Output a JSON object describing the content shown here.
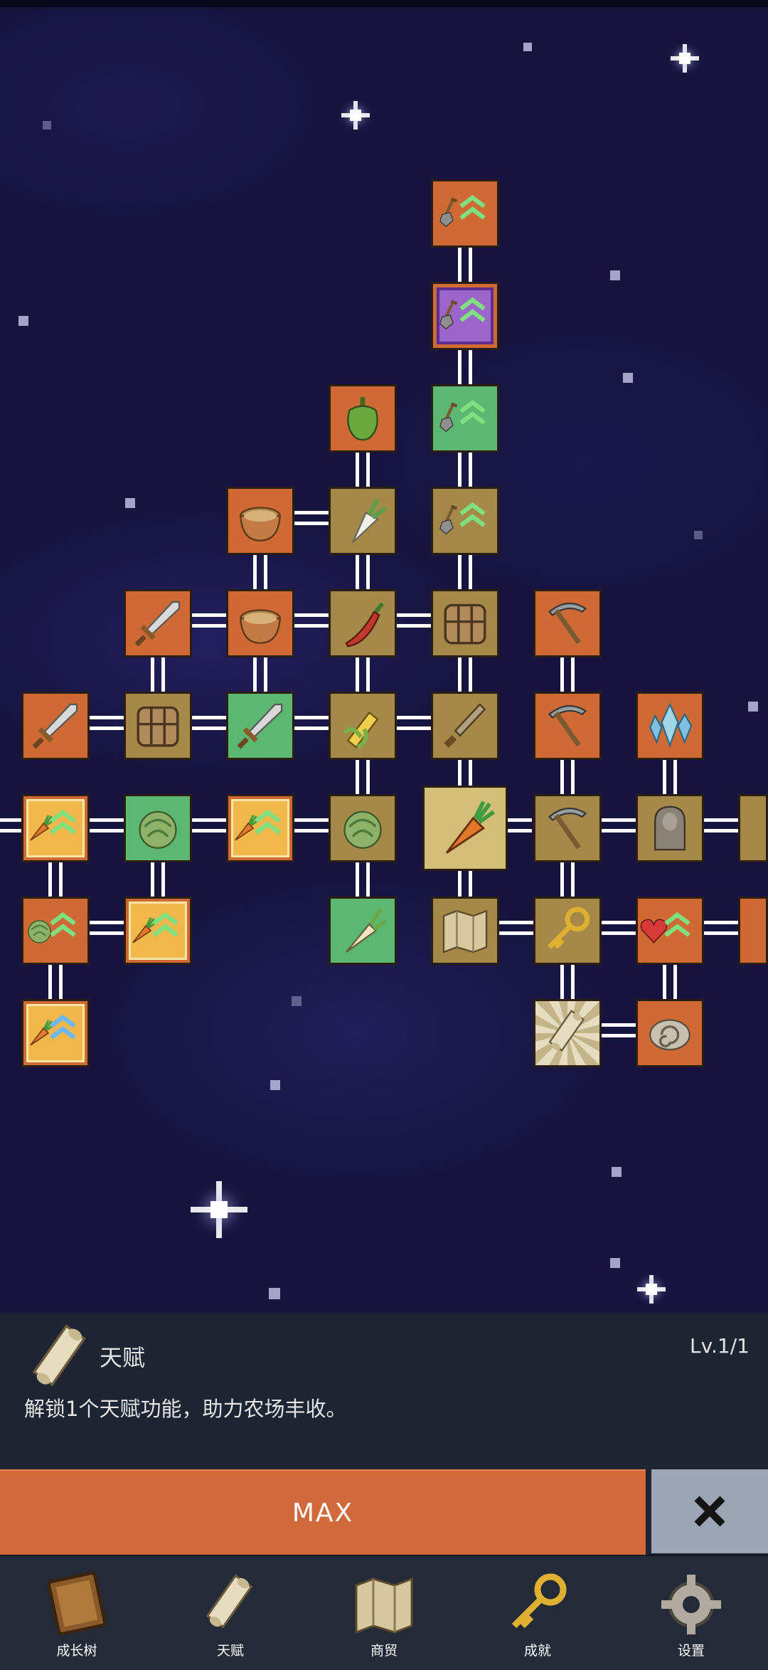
{
  "tree": {
    "nodes": [
      {
        "id": "shovel-upgrade-orange",
        "icon": "shovel-icon"
      },
      {
        "id": "shovel-upgrade-purple",
        "icon": "shovel-icon"
      },
      {
        "id": "pepper-node",
        "icon": "bell-pepper-icon"
      },
      {
        "id": "shovel-upgrade-green",
        "icon": "shovel-icon"
      },
      {
        "id": "bowl-node-top",
        "icon": "bowl-icon"
      },
      {
        "id": "radish-node",
        "icon": "radish-icon"
      },
      {
        "id": "shovel-upgrade-olive",
        "icon": "shovel-icon"
      },
      {
        "id": "sword-node-gold",
        "icon": "sword-icon"
      },
      {
        "id": "bowl-node",
        "icon": "bowl-icon"
      },
      {
        "id": "chili-node",
        "icon": "chili-pepper-icon"
      },
      {
        "id": "chest-node-top",
        "icon": "chest-icon"
      },
      {
        "id": "pickaxe-gold-node",
        "icon": "pickaxe-icon"
      },
      {
        "id": "sword-node-orange",
        "icon": "sword-icon"
      },
      {
        "id": "chest-node",
        "icon": "chest-icon"
      },
      {
        "id": "sword-node-green",
        "icon": "sword-icon"
      },
      {
        "id": "corn-node",
        "icon": "corn-icon"
      },
      {
        "id": "dagger-node",
        "icon": "dagger-icon"
      },
      {
        "id": "pickaxe-node",
        "icon": "pickaxe-icon"
      },
      {
        "id": "crystal-node",
        "icon": "crystal-icon"
      },
      {
        "id": "carrot-upgrade-1",
        "icon": "carrot-icon"
      },
      {
        "id": "cabbage-node-green",
        "icon": "cabbage-icon"
      },
      {
        "id": "carrot-upgrade-2",
        "icon": "carrot-icon"
      },
      {
        "id": "cabbage-node-olive",
        "icon": "cabbage-icon"
      },
      {
        "id": "carrot-center-node",
        "icon": "carrot-icon"
      },
      {
        "id": "pickaxe-node-2",
        "icon": "pickaxe-icon"
      },
      {
        "id": "statue-node",
        "icon": "statue-icon"
      },
      {
        "id": "cabbage-upgrade",
        "icon": "cabbage-icon"
      },
      {
        "id": "carrot-upgrade-3",
        "icon": "carrot-icon"
      },
      {
        "id": "parsnip-node",
        "icon": "parsnip-icon"
      },
      {
        "id": "map-node",
        "icon": "map-icon"
      },
      {
        "id": "key-node",
        "icon": "key-icon"
      },
      {
        "id": "heart-node",
        "icon": "heart-icon"
      },
      {
        "id": "carrot-upgrade-4",
        "icon": "carrot-icon"
      },
      {
        "id": "scroll-node",
        "icon": "scroll-icon"
      },
      {
        "id": "fossil-node",
        "icon": "fossil-icon"
      }
    ]
  },
  "panel": {
    "icon": "scroll-icon",
    "title": "天赋",
    "level": "Lv.1/1",
    "description": "解锁1个天赋功能，助力农场丰收。",
    "max_label": "MAX",
    "close_icon": "close-icon"
  },
  "navbar": {
    "items": [
      {
        "label": "成长树",
        "icon": "book-icon"
      },
      {
        "label": "天赋",
        "icon": "scroll-icon"
      },
      {
        "label": "商贸",
        "icon": "map-icon"
      },
      {
        "label": "成就",
        "icon": "key-icon"
      },
      {
        "label": "设置",
        "icon": "gear-icon"
      }
    ]
  },
  "colors": {
    "background": "#16143f",
    "node_orange": "#d06a35",
    "node_green": "#5cb870",
    "node_olive": "#a58948",
    "node_beige": "#d3bf78",
    "panel": "#1d2432",
    "max_button": "#d2693a",
    "close_button": "#9ba5b4",
    "navbar": "#232a38"
  }
}
